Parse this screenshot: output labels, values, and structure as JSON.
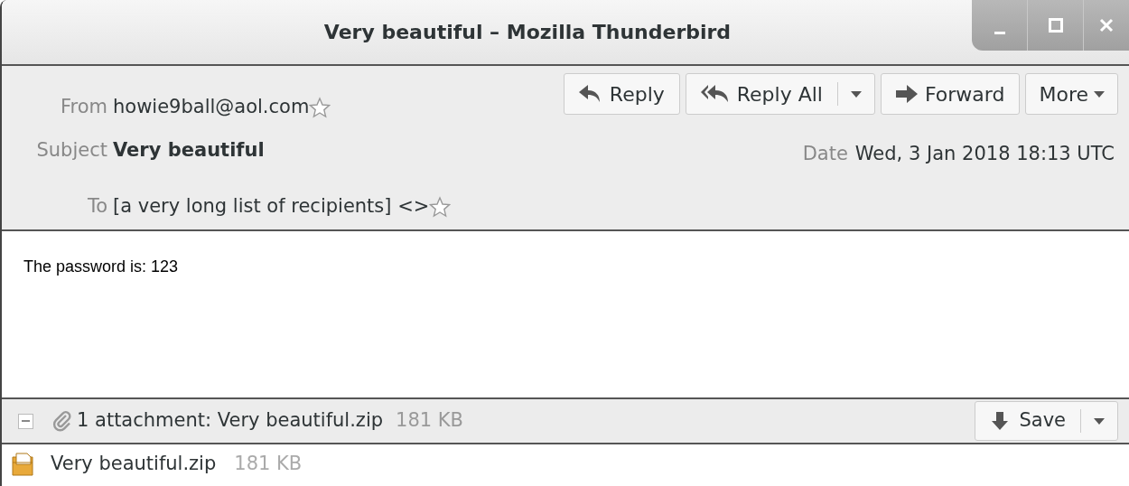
{
  "window": {
    "title": "Very beautiful – Mozilla Thunderbird"
  },
  "toolbar": [
    {
      "label": "Reply",
      "kind": "reply"
    },
    {
      "label": "Reply All",
      "kind": "reply_all_split"
    },
    {
      "label": "Forward",
      "kind": "forward"
    },
    {
      "label": "More",
      "kind": "menu"
    }
  ],
  "header": {
    "from": {
      "label": "From",
      "value": "howie9ball@aol.com",
      "starred": false
    },
    "subject": {
      "label": "Subject",
      "value": "Very beautiful"
    },
    "date": {
      "label": "Date",
      "value": "Wed, 3 Jan 2018 18:13 UTC"
    },
    "to": {
      "label": "To",
      "value": "[a very long list of recipients] <>",
      "starred": false
    }
  },
  "body": "The password is: 123",
  "attachment_bar": {
    "expanded": true,
    "summary": "1 attachment: Very beautiful.zip",
    "size": "181 KB",
    "save_label": "Save"
  },
  "attachments": [
    {
      "name": "Very beautiful.zip",
      "size": "181 KB"
    }
  ]
}
